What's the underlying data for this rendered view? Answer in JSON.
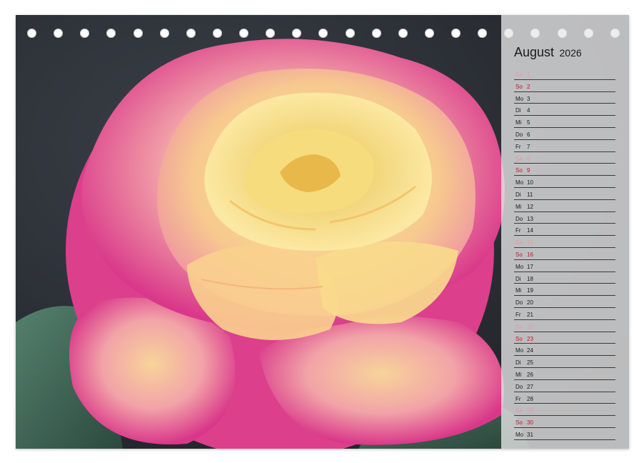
{
  "calendar": {
    "month": "August",
    "year": "2026",
    "days": [
      {
        "weekday": "Sa",
        "day": "1",
        "type": "sat"
      },
      {
        "weekday": "So",
        "day": "2",
        "type": "sun"
      },
      {
        "weekday": "Mo",
        "day": "3",
        "type": "weekday"
      },
      {
        "weekday": "Di",
        "day": "4",
        "type": "weekday"
      },
      {
        "weekday": "Mi",
        "day": "5",
        "type": "weekday"
      },
      {
        "weekday": "Do",
        "day": "6",
        "type": "weekday"
      },
      {
        "weekday": "Fr",
        "day": "7",
        "type": "weekday"
      },
      {
        "weekday": "Sa",
        "day": "8",
        "type": "sat"
      },
      {
        "weekday": "So",
        "day": "9",
        "type": "sun"
      },
      {
        "weekday": "Mo",
        "day": "10",
        "type": "weekday"
      },
      {
        "weekday": "Di",
        "day": "11",
        "type": "weekday"
      },
      {
        "weekday": "Mi",
        "day": "12",
        "type": "weekday"
      },
      {
        "weekday": "Do",
        "day": "13",
        "type": "weekday"
      },
      {
        "weekday": "Fr",
        "day": "14",
        "type": "weekday"
      },
      {
        "weekday": "Sa",
        "day": "15",
        "type": "sat"
      },
      {
        "weekday": "So",
        "day": "16",
        "type": "sun"
      },
      {
        "weekday": "Mo",
        "day": "17",
        "type": "weekday"
      },
      {
        "weekday": "Di",
        "day": "18",
        "type": "weekday"
      },
      {
        "weekday": "Mi",
        "day": "19",
        "type": "weekday"
      },
      {
        "weekday": "Do",
        "day": "20",
        "type": "weekday"
      },
      {
        "weekday": "Fr",
        "day": "21",
        "type": "weekday"
      },
      {
        "weekday": "Sa",
        "day": "22",
        "type": "sat"
      },
      {
        "weekday": "So",
        "day": "23",
        "type": "sun"
      },
      {
        "weekday": "Mo",
        "day": "24",
        "type": "weekday"
      },
      {
        "weekday": "Di",
        "day": "25",
        "type": "weekday"
      },
      {
        "weekday": "Mi",
        "day": "26",
        "type": "weekday"
      },
      {
        "weekday": "Do",
        "day": "27",
        "type": "weekday"
      },
      {
        "weekday": "Fr",
        "day": "28",
        "type": "weekday"
      },
      {
        "weekday": "Sa",
        "day": "29",
        "type": "sat"
      },
      {
        "weekday": "So",
        "day": "30",
        "type": "sun"
      },
      {
        "weekday": "Mo",
        "day": "31",
        "type": "weekday"
      }
    ]
  },
  "binding": {
    "ring_count": 23
  },
  "colors": {
    "sunday": "#c8102e",
    "saturday": "#e39aa6",
    "panel": "#e8e8e8",
    "background": "#2a2d33"
  },
  "photo": {
    "subject": "rose-flower-photo"
  }
}
